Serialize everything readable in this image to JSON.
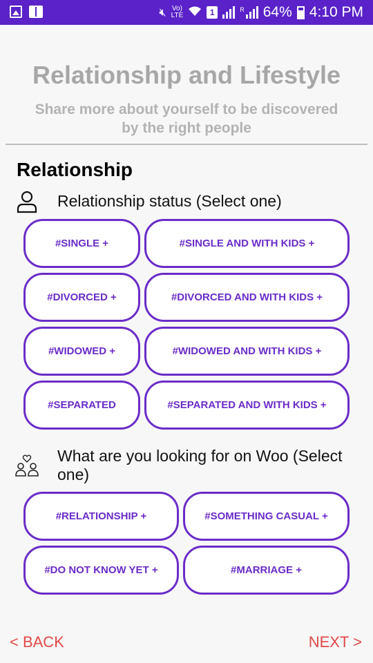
{
  "status_bar": {
    "volte": "Vo)",
    "lte": "LTE",
    "sim": "1",
    "roaming": "R",
    "battery": "64%",
    "time": "4:10 PM"
  },
  "page": {
    "title": "Relationship and Lifestyle",
    "subtitle": "Share more about yourself to be discovered by the right people"
  },
  "section": {
    "heading": "Relationship"
  },
  "question1": {
    "icon": "person-icon",
    "label": "Relationship status (Select one)",
    "options": [
      "#SINGLE +",
      "#SINGLE AND WITH KIDS +",
      "#DIVORCED +",
      "#DIVORCED AND WITH KIDS +",
      "#WIDOWED +",
      "#WIDOWED AND WITH KIDS +",
      "#SEPARATED",
      "#SEPARATED AND WITH KIDS +"
    ]
  },
  "question2": {
    "icon": "couple-heart-icon",
    "label": "What are you looking for on Woo (Select one)",
    "options": [
      "#RELATIONSHIP +",
      "#SOMETHING CASUAL +",
      "#DO NOT KNOW YET +",
      "#MARRIAGE +"
    ]
  },
  "nav": {
    "back": "< BACK",
    "next": "NEXT >"
  },
  "colors": {
    "status_bar": "#5a22c8",
    "accent": "#6a2cc8",
    "nav": "#e04848"
  }
}
